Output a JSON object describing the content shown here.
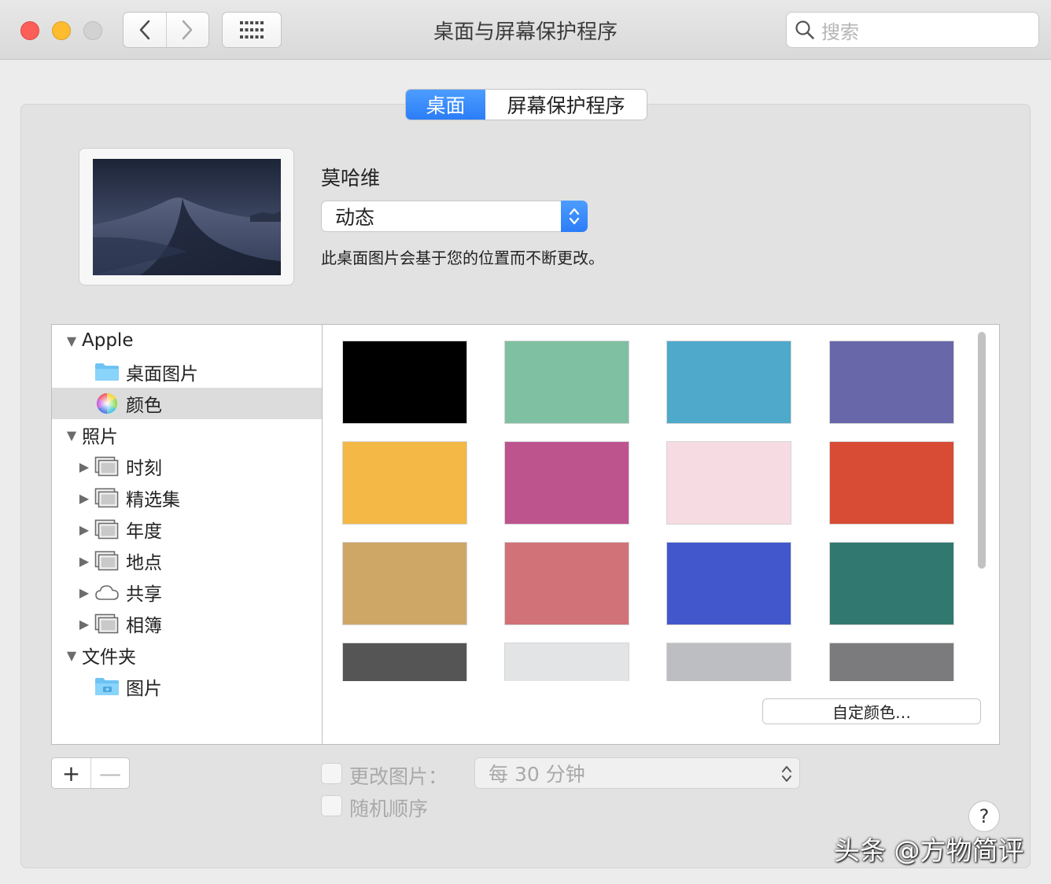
{
  "window": {
    "title": "桌面与屏幕保护程序",
    "search_placeholder": "搜索"
  },
  "tabs": [
    {
      "label": "桌面",
      "active": true
    },
    {
      "label": "屏幕保护程序",
      "active": false
    }
  ],
  "wallpaper": {
    "name": "莫哈维",
    "mode": "动态",
    "description": "此桌面图片会基于您的位置而不断更改。"
  },
  "sidebar": {
    "items": [
      {
        "label": "Apple",
        "disclosure": "expanded",
        "icon": "none",
        "selected": false
      },
      {
        "label": "桌面图片",
        "disclosure": "none",
        "icon": "folder-icon",
        "selected": false
      },
      {
        "label": "颜色",
        "disclosure": "none",
        "icon": "color-wheel-icon",
        "selected": true
      },
      {
        "label": "照片",
        "disclosure": "expanded",
        "icon": "none",
        "selected": false
      },
      {
        "label": "时刻",
        "disclosure": "collapsed",
        "icon": "photo-stack-icon",
        "selected": false
      },
      {
        "label": "精选集",
        "disclosure": "collapsed",
        "icon": "photo-stack-icon",
        "selected": false
      },
      {
        "label": "年度",
        "disclosure": "collapsed",
        "icon": "photo-stack-icon",
        "selected": false
      },
      {
        "label": "地点",
        "disclosure": "collapsed",
        "icon": "photo-stack-icon",
        "selected": false
      },
      {
        "label": "共享",
        "disclosure": "collapsed",
        "icon": "cloud-icon",
        "selected": false
      },
      {
        "label": "相簿",
        "disclosure": "collapsed",
        "icon": "photo-stack-icon",
        "selected": false
      },
      {
        "label": "文件夹",
        "disclosure": "expanded",
        "icon": "none",
        "selected": false
      },
      {
        "label": "图片",
        "disclosure": "none",
        "icon": "pictures-folder-icon",
        "selected": false
      }
    ]
  },
  "colors": [
    "#000000",
    "#80c0a2",
    "#4ea9cb",
    "#6867a9",
    "#f3b845",
    "#bd548e",
    "#f6dce2",
    "#d84b34",
    "#cea766",
    "#d17278",
    "#4257cc",
    "#317870",
    "#555555",
    "#e3e4e6",
    "#bdbec2",
    "#7b7b7e"
  ],
  "buttons": {
    "custom_color": "自定颜色…",
    "add": "+",
    "remove": "—",
    "help": "?"
  },
  "options": {
    "change_picture_label": "更改图片：",
    "change_picture_checked": false,
    "interval": "每 30 分钟",
    "random_order_label": "随机顺序",
    "random_order_checked": false
  },
  "watermark": "头条 @方物简评",
  "accent_color": "#2b7df7"
}
